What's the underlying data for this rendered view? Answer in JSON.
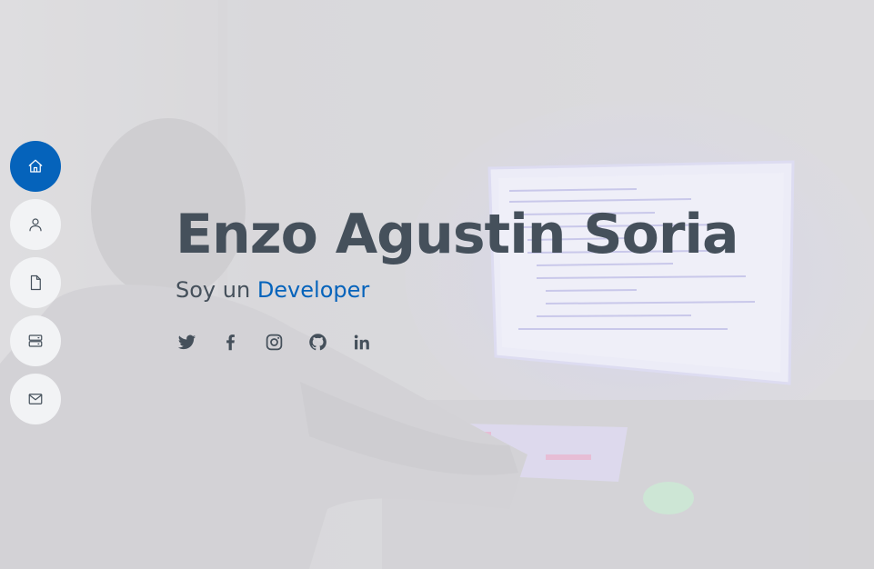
{
  "nav": {
    "items": [
      {
        "name": "home",
        "icon": "home-icon",
        "active": true
      },
      {
        "name": "about",
        "icon": "user-icon",
        "active": false
      },
      {
        "name": "resume",
        "icon": "file-icon",
        "active": false
      },
      {
        "name": "services",
        "icon": "server-icon",
        "active": false
      },
      {
        "name": "contact",
        "icon": "envelope-icon",
        "active": false
      }
    ]
  },
  "hero": {
    "name": "Enzo Agustin Soria",
    "subtitle_prefix": "Soy un",
    "typed_text": "Developer",
    "social": [
      {
        "name": "twitter",
        "icon": "twitter-icon"
      },
      {
        "name": "facebook",
        "icon": "facebook-icon"
      },
      {
        "name": "instagram",
        "icon": "instagram-icon"
      },
      {
        "name": "github",
        "icon": "github-icon"
      },
      {
        "name": "linkedin",
        "icon": "linkedin-icon"
      }
    ]
  },
  "colors": {
    "accent": "#0563bb",
    "text": "#45505b",
    "nav_bg": "#f2f3f5"
  }
}
